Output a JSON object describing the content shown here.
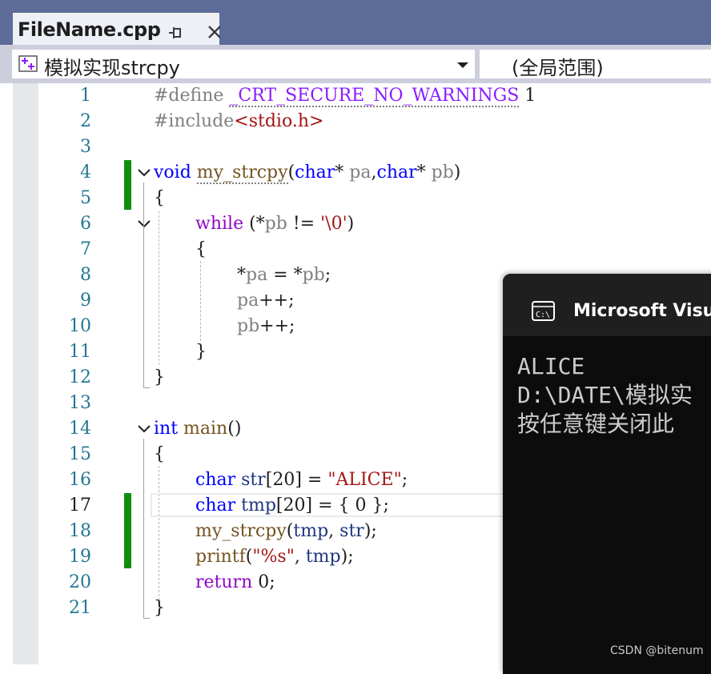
{
  "tab": {
    "title": "FileName.cpp"
  },
  "nav": {
    "scope": "模拟实现strcpy",
    "global_scope": "(全局范围)"
  },
  "editor": {
    "lines": [
      {
        "n": "1"
      },
      {
        "n": "2"
      },
      {
        "n": "3"
      },
      {
        "n": "4"
      },
      {
        "n": "5"
      },
      {
        "n": "6"
      },
      {
        "n": "7"
      },
      {
        "n": "8"
      },
      {
        "n": "9"
      },
      {
        "n": "10"
      },
      {
        "n": "11"
      },
      {
        "n": "12"
      },
      {
        "n": "13"
      },
      {
        "n": "14"
      },
      {
        "n": "15"
      },
      {
        "n": "16"
      },
      {
        "n": "17"
      },
      {
        "n": "18"
      },
      {
        "n": "19"
      },
      {
        "n": "20"
      },
      {
        "n": "21"
      }
    ],
    "code": {
      "l1": [
        "#define ",
        "_CRT_SECURE_NO_WARNINGS",
        " 1"
      ],
      "l2": [
        "#include",
        "<stdio.h>"
      ],
      "l4": [
        "void",
        " ",
        "my_strcpy",
        "(",
        "char",
        "* ",
        "pa",
        ",",
        "char",
        "* ",
        "pb",
        ")"
      ],
      "l5": [
        "{"
      ],
      "l6": [
        "while",
        " (*",
        "pb",
        " != ",
        "'\\0'",
        ")"
      ],
      "l7": [
        "{"
      ],
      "l8": [
        "*",
        "pa",
        " = *",
        "pb",
        ";"
      ],
      "l9": [
        "pa",
        "++;"
      ],
      "l10": [
        "pb",
        "++;"
      ],
      "l11": [
        "}"
      ],
      "l12": [
        "}"
      ],
      "l14": [
        "int",
        " ",
        "main",
        "()"
      ],
      "l15": [
        "{"
      ],
      "l16": [
        "char",
        " ",
        "str",
        "[20] = ",
        "\"ALICE\"",
        ";"
      ],
      "l17": [
        "char",
        " ",
        "tmp",
        "[20] = { 0 };"
      ],
      "l18": [
        "my_strcpy",
        "(",
        "tmp",
        ", ",
        "str",
        ");"
      ],
      "l19": [
        "printf",
        "(",
        "\"%s\"",
        ", ",
        "tmp",
        ");"
      ],
      "l20": [
        "return",
        " 0;"
      ],
      "l21": [
        "}"
      ]
    },
    "current_line": 17
  },
  "console": {
    "title": "Microsoft Visua",
    "lines": [
      "ALICE",
      "D:\\DATE\\模拟实",
      "按任意键关闭此"
    ]
  },
  "watermark": "CSDN @bitenum"
}
